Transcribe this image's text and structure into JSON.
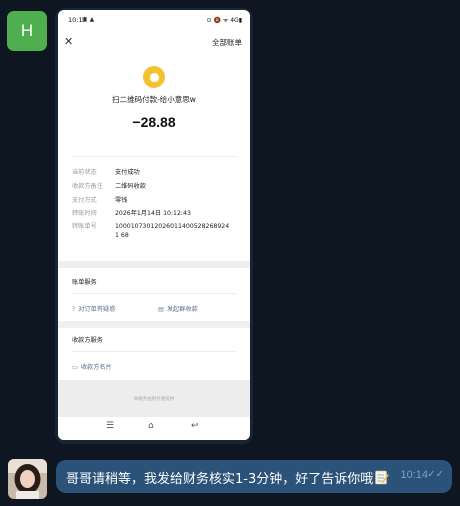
{
  "sender": {
    "avatar_letter": "H"
  },
  "receipt": {
    "status_bar": {
      "time": "10:12",
      "right": "⊙ 🔕 ᯤ 4G▮"
    },
    "close_glyph": "✕",
    "header_link": "全部账单",
    "payee": "扫二维码付款-给小意思w",
    "amount": "−28.88",
    "details": [
      {
        "label": "当前状态",
        "value": "支付成功"
      },
      {
        "label": "收款方备注",
        "value": "二维码收款"
      },
      {
        "label": "支付方式",
        "value": "零钱"
      },
      {
        "label": "转账时间",
        "value": "2026年1月14日 10:12:43"
      },
      {
        "label": "转账单号",
        "value": "100010730120260114005282689241 68"
      }
    ],
    "bill_service": {
      "title": "账单服务",
      "question_link": "对订单有疑惑",
      "group_receipt_link": "发起群收款"
    },
    "payee_service": {
      "title": "收款方服务",
      "card_link": "收款方名片"
    },
    "footer_note": "本服务由财付通提供",
    "nav": {
      "menu": "☰",
      "home": "⌂",
      "back": "↩"
    }
  },
  "reply": {
    "text": "哥哥请稍等，我发给财务核实1-3分钟，好了告诉你哦",
    "time": "10:14",
    "check": "✓✓"
  },
  "colors": {
    "background": "#0e1621",
    "outgoing_bubble": "#2b5278",
    "avatar_h": "#4fae4e",
    "coin": "#f3c230"
  }
}
